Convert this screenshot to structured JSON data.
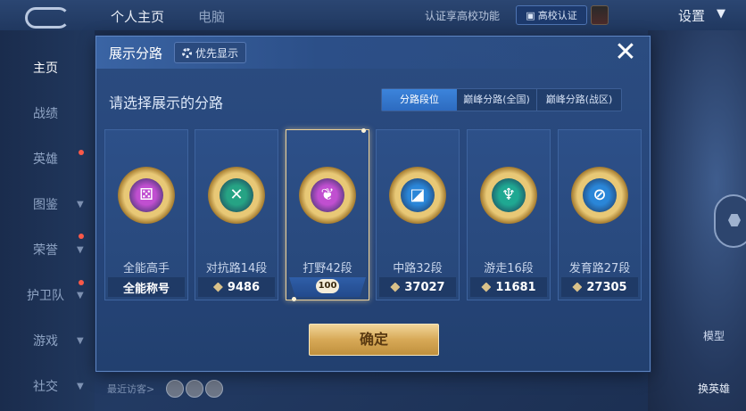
{
  "topbar": {
    "tabs": [
      "个人主页",
      "电脑"
    ],
    "campus_text": "认证享高校功能",
    "campus_button": "高校认证",
    "settings": "设置"
  },
  "sidebar": {
    "items": [
      "主页",
      "战绩",
      "英雄",
      "图鉴",
      "荣誉",
      "护卫队",
      "游戏",
      "社交"
    ]
  },
  "background": {
    "model_label": "模型",
    "swap_label": "换英雄",
    "visitors_label": "最近访客>"
  },
  "modal": {
    "title": "展示分路",
    "priority_button": "优先显示",
    "close_icon": "✕",
    "prompt": "请选择展示的分路",
    "tabs": [
      "分路段位",
      "巅峰分路(全国)",
      "巅峰分路(战区)"
    ],
    "active_tab": "分路段位",
    "cards": [
      {
        "lane": "全能高手",
        "footer": "全能称号",
        "color": "#c04fd0",
        "icon": "all-round-icon",
        "selected": false
      },
      {
        "lane": "对抗路14段",
        "footer": "9486",
        "color": "#26a384",
        "icon": "clash-lane-icon",
        "selected": false
      },
      {
        "lane": "打野42段",
        "footer": "",
        "rank_number": "100",
        "color": "#c04fd0",
        "icon": "jungle-icon",
        "selected": true
      },
      {
        "lane": "中路32段",
        "footer": "37027",
        "color": "#2a86d8",
        "icon": "mid-lane-icon",
        "selected": false
      },
      {
        "lane": "游走16段",
        "footer": "11681",
        "color": "#1fa892",
        "icon": "roam-icon",
        "selected": false
      },
      {
        "lane": "发育路27段",
        "footer": "27305",
        "color": "#2a86d8",
        "icon": "farm-lane-icon",
        "selected": false
      }
    ],
    "confirm": "确定"
  }
}
